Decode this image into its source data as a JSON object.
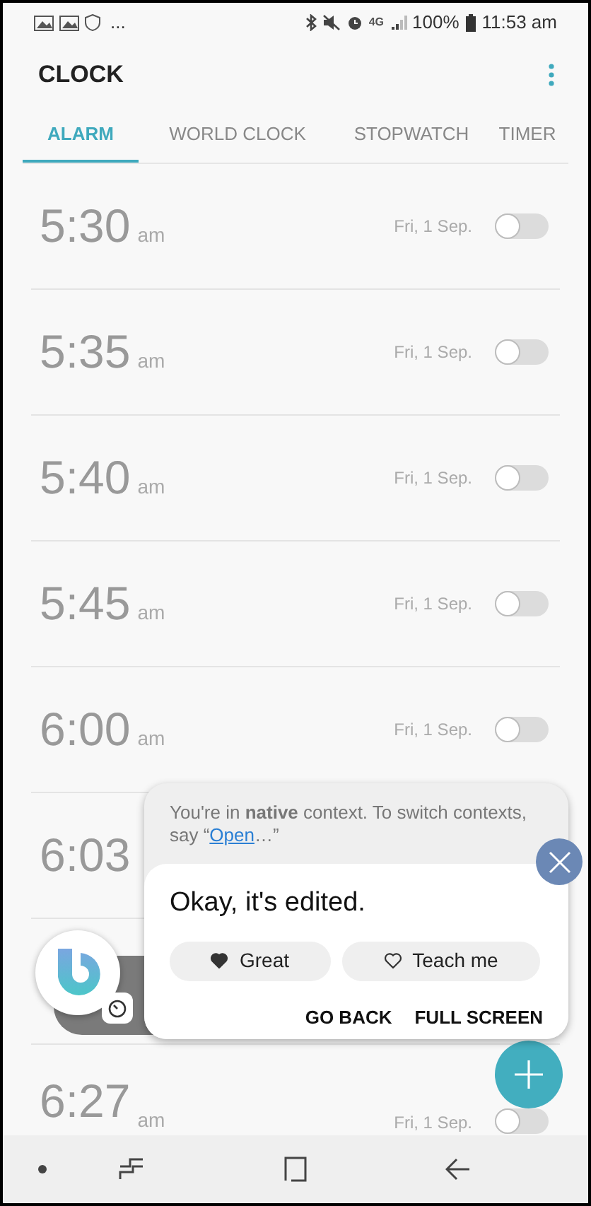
{
  "status_bar": {
    "more": "...",
    "battery": "100%",
    "time": "11:53 am",
    "network": "4G"
  },
  "app_bar": {
    "title": "CLOCK"
  },
  "tabs": [
    {
      "label": "ALARM",
      "selected": true
    },
    {
      "label": "WORLD CLOCK",
      "selected": false
    },
    {
      "label": "STOPWATCH",
      "selected": false
    },
    {
      "label": "TIMER",
      "selected": false
    }
  ],
  "alarms": [
    {
      "time": "5:30",
      "period": "am",
      "date": "Fri, 1 Sep.",
      "on": false
    },
    {
      "time": "5:35",
      "period": "am",
      "date": "Fri, 1 Sep.",
      "on": false
    },
    {
      "time": "5:40",
      "period": "am",
      "date": "Fri, 1 Sep.",
      "on": false
    },
    {
      "time": "5:45",
      "period": "am",
      "date": "Fri, 1 Sep.",
      "on": false
    },
    {
      "time": "6:00",
      "period": "am",
      "date": "Fri, 1 Sep.",
      "on": false
    },
    {
      "time": "6:03"
    },
    {
      "kind": "covered"
    },
    {
      "time": "6:27",
      "period": "am",
      "date": "Fri, 1 Sep.",
      "on": false
    }
  ],
  "assistant": {
    "context": "You're in **native** context. To switch contexts, say “",
    "link": "Open",
    "context_end": "…”",
    "message": "Okay, it's edited.",
    "chips": [
      {
        "label": "Great",
        "kind": "filled"
      },
      {
        "label": "Teach me",
        "kind": "outline"
      }
    ],
    "actions": [
      "GO BACK",
      "FULL SCREEN"
    ]
  }
}
